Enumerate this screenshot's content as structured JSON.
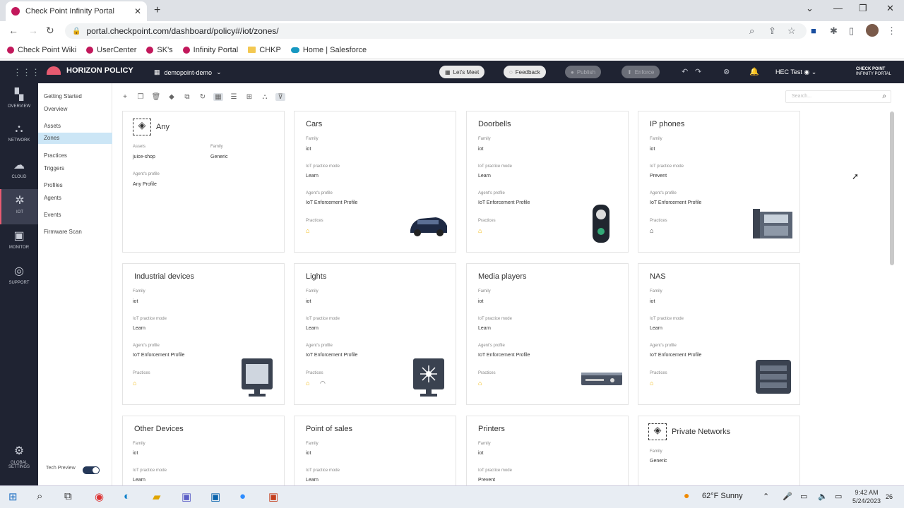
{
  "browser": {
    "tab_title": "Check Point Infinity Portal",
    "url": "portal.checkpoint.com/dashboard/policy#/iot/zones/",
    "bookmarks": [
      "Check Point Wiki",
      "UserCenter",
      "SK's",
      "Infinity Portal",
      "CHKP",
      "Home | Salesforce"
    ]
  },
  "app": {
    "product": "HORIZON POLICY",
    "environment": "demopoint-demo",
    "lets_meet": "Let's Meet",
    "feedback": "Feedback",
    "publish": "Publish",
    "enforce": "Enforce",
    "user": "HEC Test",
    "brand_line1": "CHECK POINT",
    "brand_line2": "INFINITY PORTAL"
  },
  "rail": [
    {
      "label": "OVERVIEW",
      "icon": "dashboard-icon"
    },
    {
      "label": "NETWORK",
      "icon": "network-icon"
    },
    {
      "label": "CLOUD",
      "icon": "cloud-icon"
    },
    {
      "label": "IOT",
      "icon": "iot-icon"
    },
    {
      "label": "MONITOR",
      "icon": "monitor-icon"
    },
    {
      "label": "SUPPORT",
      "icon": "support-icon"
    },
    {
      "label": "GLOBAL SETTINGS",
      "icon": "gear-icon"
    }
  ],
  "subnav": {
    "getting_started": "Getting Started",
    "overview": "Overview",
    "assets": "Assets",
    "zones": "Zones",
    "practices": "Practices",
    "triggers": "Triggers",
    "profiles": "Profiles",
    "agents": "Agents",
    "events": "Events",
    "firmware": "Firmware Scan",
    "tech_preview": "Tech Preview"
  },
  "search": {
    "placeholder": "Search..."
  },
  "labels": {
    "family": "Family",
    "mode": "IoT practice mode",
    "profile": "Agent's profile",
    "practices": "Practices",
    "assets": "Assets"
  },
  "cards": [
    {
      "title": "Any",
      "assets": "juice-shop",
      "family": "Generic",
      "profile": "Any Profile"
    },
    {
      "title": "Cars",
      "family": "iot",
      "mode": "Learn",
      "profile": "IoT Enforcement Profile"
    },
    {
      "title": "Doorbells",
      "family": "iot",
      "mode": "Learn",
      "profile": "IoT Enforcement Profile"
    },
    {
      "title": "IP phones",
      "family": "iot",
      "mode": "Prevent",
      "profile": "IoT Enforcement Profile"
    },
    {
      "title": "Industrial devices",
      "family": "iot",
      "mode": "Learn",
      "profile": "IoT Enforcement Profile"
    },
    {
      "title": "Lights",
      "family": "iot",
      "mode": "Learn",
      "profile": "IoT Enforcement Profile"
    },
    {
      "title": "Media players",
      "family": "iot",
      "mode": "Learn",
      "profile": "IoT Enforcement Profile"
    },
    {
      "title": "NAS",
      "family": "iot",
      "mode": "Learn",
      "profile": "IoT Enforcement Profile"
    },
    {
      "title": "Other Devices",
      "family": "iot",
      "mode": "Learn"
    },
    {
      "title": "Point of sales",
      "family": "iot",
      "mode": "Learn"
    },
    {
      "title": "Printers",
      "family": "iot",
      "mode": "Prevent"
    },
    {
      "title": "Private Networks",
      "family": "Generic"
    }
  ],
  "taskbar": {
    "weather": "62°F  Sunny",
    "time": "9:42 AM",
    "date": "5/24/2023",
    "notif": "26"
  }
}
